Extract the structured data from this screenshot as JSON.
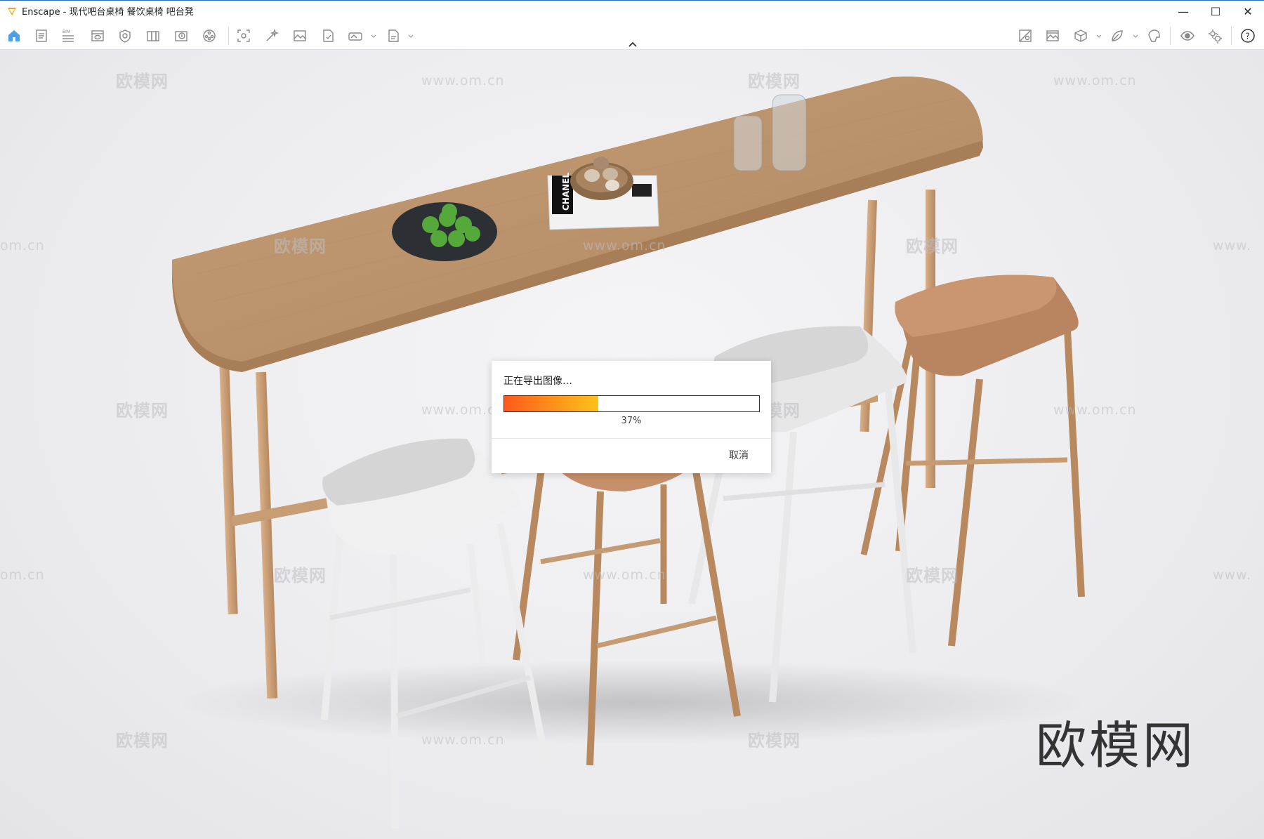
{
  "window": {
    "title": "Enscape - 现代吧台桌椅 餐饮桌椅 吧台凳",
    "controls": {
      "minimize": "—",
      "maximize": "☐",
      "close": "✕"
    }
  },
  "toolbar": {
    "left_icons": [
      "home-icon",
      "document-icon",
      "bim-icon",
      "view-icon",
      "visual-settings-icon",
      "library-icon",
      "asset-import-icon",
      "video-icon",
      "screenshot-icon",
      "magic-icon",
      "image-icon",
      "export-icon",
      "panorama-icon",
      "batch-export-icon"
    ],
    "right_icons": [
      "map-icon",
      "gallery-icon",
      "cube-icon",
      "material-icon",
      "vr-icon",
      "eye-icon",
      "settings-icon",
      "help-icon"
    ],
    "bim_label": "BIM",
    "help_label": "?"
  },
  "viewport": {
    "watermark_text": "欧模网",
    "watermark_url": "www.om.cn",
    "watermark_url_partial_left": "om.cn",
    "watermark_url_partial_right": "www.",
    "brand": "欧模网",
    "book_text": "CHANEL"
  },
  "dialog": {
    "message": "正在导出图像…",
    "progress": 0.37,
    "progress_label": "37%",
    "cancel_label": "取消",
    "colors": {
      "start": "#ff5a1a",
      "end": "#ffc21a"
    }
  }
}
